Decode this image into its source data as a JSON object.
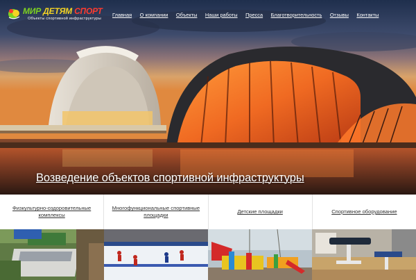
{
  "header": {
    "logo": {
      "title_part1": "МИР",
      "title_part2": "ДЕТЯМ",
      "title_part3": "СПОРТ",
      "subtitle": "Объекты спортивной инфраструктуры"
    },
    "nav": [
      {
        "label": "Главная"
      },
      {
        "label": "О компании"
      },
      {
        "label": "Объекты"
      },
      {
        "label": "Наши работы"
      },
      {
        "label": "Пресса"
      },
      {
        "label": "Благотворительность"
      },
      {
        "label": "Отзывы"
      },
      {
        "label": "Контакты"
      }
    ]
  },
  "hero": {
    "title": "Возведение объектов спортивной инфраструктуры"
  },
  "categories": [
    {
      "label": "Физкультурно-оздоровительные комплексы"
    },
    {
      "label": "Многофункциональные спортивные площадки"
    },
    {
      "label": "Детские площадки"
    },
    {
      "label": "Спортивное оборудование"
    }
  ],
  "colors": {
    "logo_green": "#7ed321",
    "logo_yellow": "#f5d423",
    "logo_red": "#ff3b2f"
  }
}
